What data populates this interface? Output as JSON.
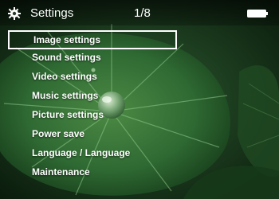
{
  "header": {
    "icon": "gear-icon",
    "title": "Settings",
    "page_indicator": "1/8",
    "battery_icon": "battery-icon"
  },
  "menu": {
    "selected_index": 0,
    "items": [
      {
        "label": "Image settings"
      },
      {
        "label": "Sound settings"
      },
      {
        "label": "Video settings"
      },
      {
        "label": "Music settings"
      },
      {
        "label": "Picture settings"
      },
      {
        "label": "Power save"
      },
      {
        "label": "Language / Language"
      },
      {
        "label": "Maintenance"
      }
    ]
  },
  "colors": {
    "text": "#ffffff",
    "highlight_border": "#ffffff",
    "background": "#1f4a24"
  }
}
